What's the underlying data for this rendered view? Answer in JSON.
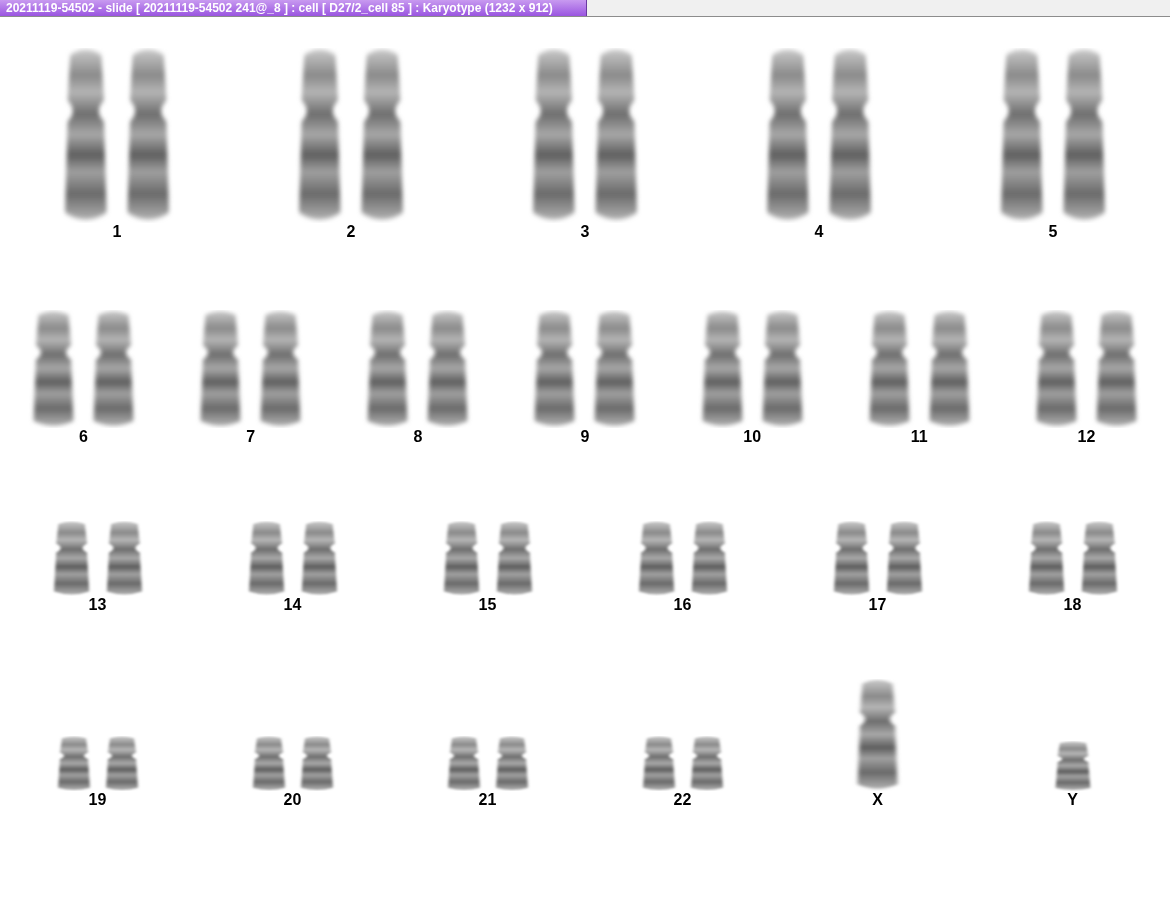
{
  "window": {
    "title": "20211119-54502 - slide [ 20211119-54502 241@_8 ] : cell [ D27/2_cell 85 ] : Karyotype  (1232 x 912)"
  },
  "rows": [
    {
      "items": [
        {
          "label": "1",
          "kind": "pair"
        },
        {
          "label": "2",
          "kind": "pair"
        },
        {
          "label": "3",
          "kind": "pair"
        },
        {
          "label": "4",
          "kind": "pair"
        },
        {
          "label": "5",
          "kind": "pair"
        }
      ]
    },
    {
      "items": [
        {
          "label": "6",
          "kind": "pair"
        },
        {
          "label": "7",
          "kind": "pair"
        },
        {
          "label": "8",
          "kind": "pair"
        },
        {
          "label": "9",
          "kind": "pair"
        },
        {
          "label": "10",
          "kind": "pair"
        },
        {
          "label": "11",
          "kind": "pair"
        },
        {
          "label": "12",
          "kind": "pair"
        }
      ]
    },
    {
      "items": [
        {
          "label": "13",
          "kind": "pair"
        },
        {
          "label": "14",
          "kind": "pair"
        },
        {
          "label": "15",
          "kind": "pair"
        },
        {
          "label": "16",
          "kind": "pair"
        },
        {
          "label": "17",
          "kind": "pair"
        },
        {
          "label": "18",
          "kind": "pair"
        }
      ]
    },
    {
      "items": [
        {
          "label": "19",
          "kind": "pair"
        },
        {
          "label": "20",
          "kind": "pair"
        },
        {
          "label": "21",
          "kind": "pair"
        },
        {
          "label": "22",
          "kind": "pair"
        },
        {
          "label": "X",
          "kind": "tall"
        },
        {
          "label": "Y",
          "kind": "single"
        }
      ]
    }
  ]
}
